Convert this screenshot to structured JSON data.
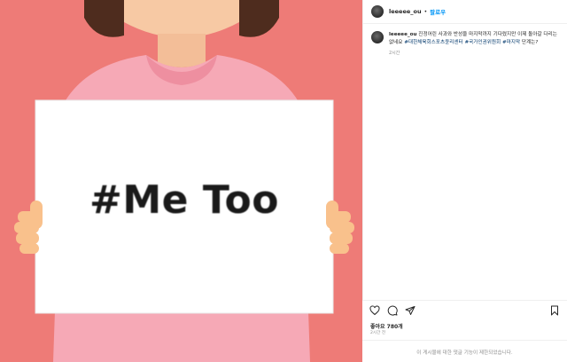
{
  "post": {
    "sign_text": "#Me Too"
  },
  "header": {
    "username": "leeeee_ou",
    "separator": "•",
    "follow_label": "팔로우"
  },
  "caption": {
    "username": "leeeee_ou",
    "text": "진정어린 사과와 반성을 마지막까지 기다렸지만 이제 돌아갈 다리는 없네요",
    "tags": [
      "#대한체육회스포츠윤리센터",
      "#국가인권위원회",
      "#마지막"
    ],
    "tail": "단계는?",
    "time": "2시간"
  },
  "actions": {
    "icons": [
      "heart-icon",
      "comment-icon",
      "share-icon",
      "bookmark-icon"
    ],
    "likes": "좋아요 780개",
    "date": "2시간 전",
    "comments_disabled": "이 게시물에 대한 댓글 기능이 제한되었습니다."
  }
}
